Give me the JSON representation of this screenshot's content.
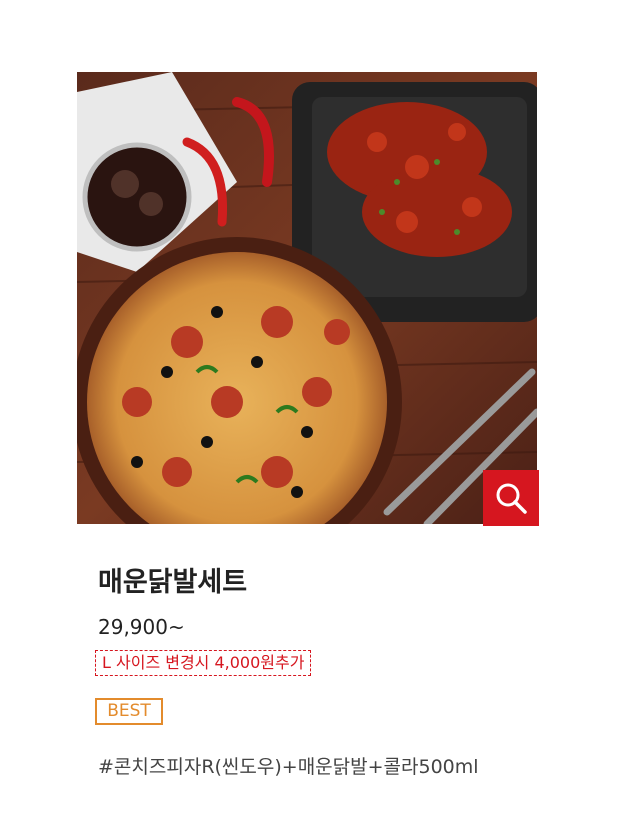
{
  "product": {
    "title": "매운닭발세트",
    "price": "29,900~",
    "upgrade_note": "L 사이즈 변경시 4,000원추가",
    "badge": "BEST",
    "description": "#콘치즈피자R(씬도우)+매운닭발+콜라500ml"
  },
  "icons": {
    "zoom": "magnifier-icon"
  },
  "colors": {
    "accent_red": "#d6161f",
    "badge_orange": "#e38b2c",
    "text_dark": "#222222"
  }
}
